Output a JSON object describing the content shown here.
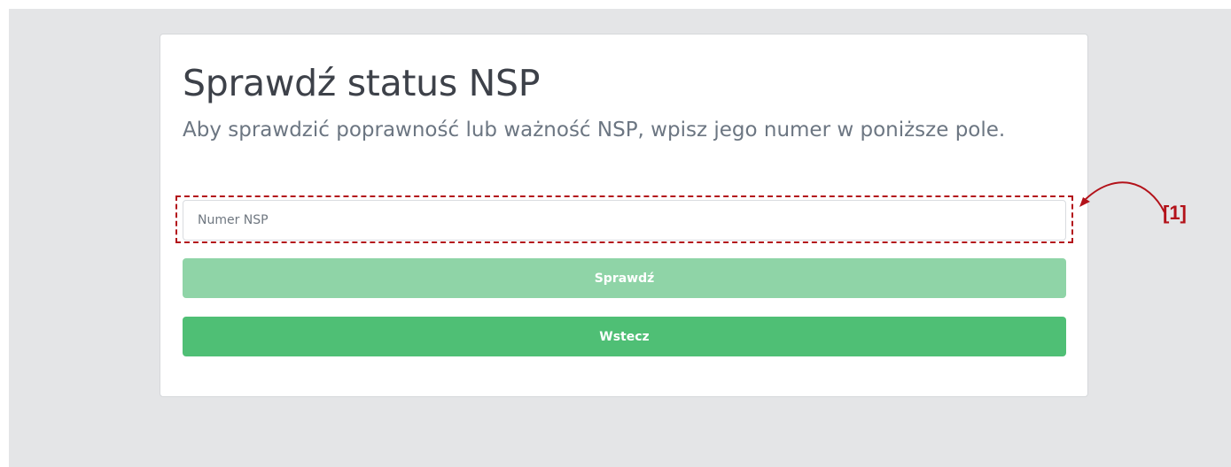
{
  "page": {
    "title": "Sprawdź status NSP",
    "subtitle": "Aby sprawdzić poprawność lub ważność NSP, wpisz jego numer w poniższe pole."
  },
  "form": {
    "nsp_number": {
      "placeholder": "Numer NSP",
      "value": ""
    },
    "check_button_label": "Sprawdź",
    "back_button_label": "Wstecz"
  },
  "annotation": {
    "label": "[1]",
    "color": "#b3121a"
  },
  "colors": {
    "background": "#e4e5e7",
    "card": "#ffffff",
    "check_button": "#8fd4a7",
    "back_button": "#4fbf75"
  }
}
